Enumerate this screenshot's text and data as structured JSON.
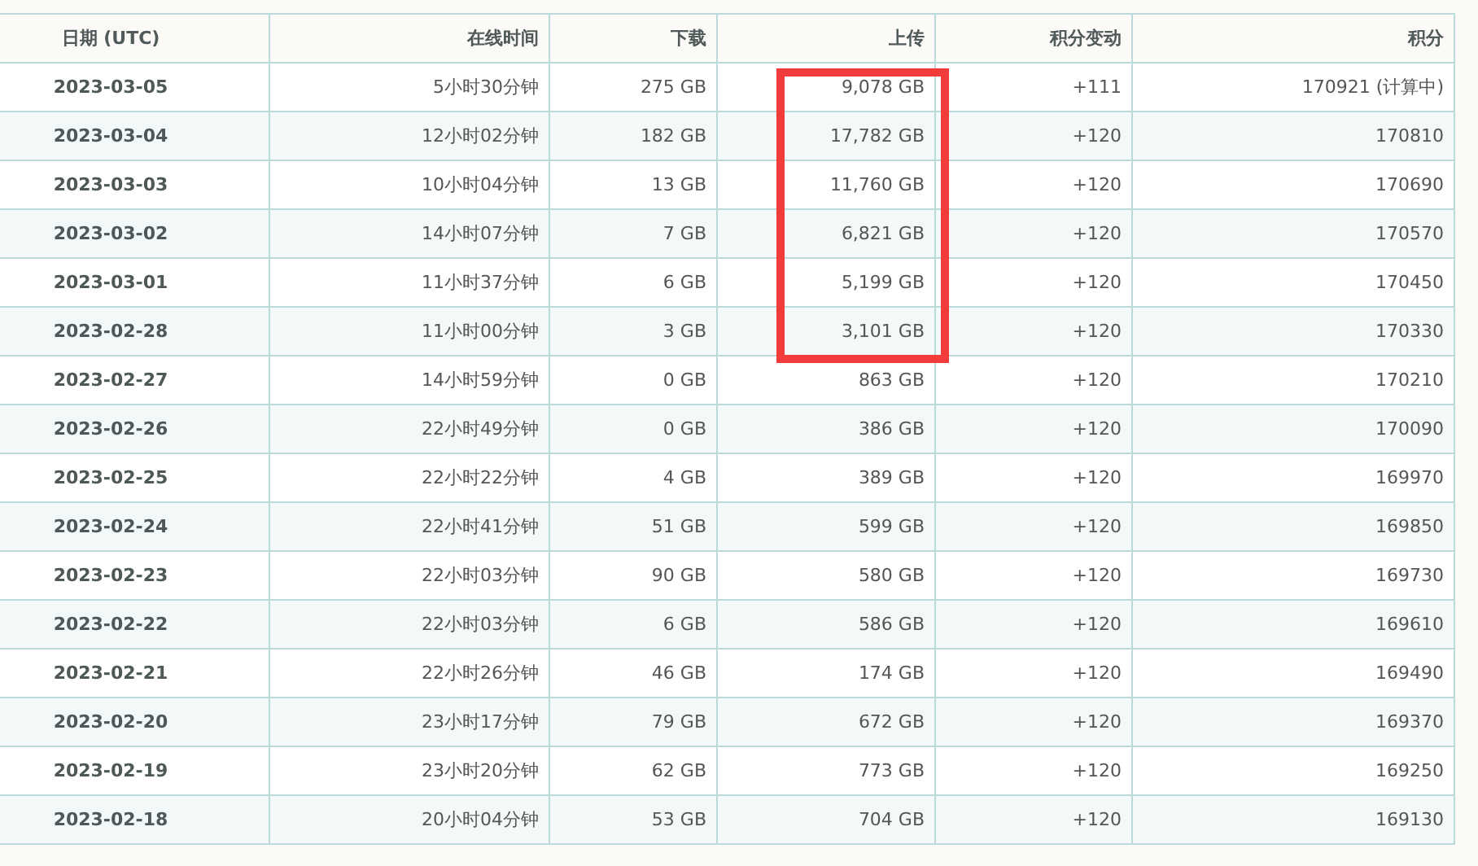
{
  "annotation": {
    "kind": "box"
  },
  "table": {
    "columns": [
      "日期 (UTC)",
      "在线时间",
      "下载",
      "上传",
      "积分变动",
      "积分"
    ],
    "rows": [
      {
        "date": "2023-03-05",
        "online": "5小时30分钟",
        "download": "275 GB",
        "upload": "9,078 GB",
        "change": "+111",
        "points": "170921 (计算中)"
      },
      {
        "date": "2023-03-04",
        "online": "12小时02分钟",
        "download": "182 GB",
        "upload": "17,782 GB",
        "change": "+120",
        "points": "170810"
      },
      {
        "date": "2023-03-03",
        "online": "10小时04分钟",
        "download": "13 GB",
        "upload": "11,760 GB",
        "change": "+120",
        "points": "170690"
      },
      {
        "date": "2023-03-02",
        "online": "14小时07分钟",
        "download": "7 GB",
        "upload": "6,821 GB",
        "change": "+120",
        "points": "170570"
      },
      {
        "date": "2023-03-01",
        "online": "11小时37分钟",
        "download": "6 GB",
        "upload": "5,199 GB",
        "change": "+120",
        "points": "170450"
      },
      {
        "date": "2023-02-28",
        "online": "11小时00分钟",
        "download": "3 GB",
        "upload": "3,101 GB",
        "change": "+120",
        "points": "170330"
      },
      {
        "date": "2023-02-27",
        "online": "14小时59分钟",
        "download": "0 GB",
        "upload": "863 GB",
        "change": "+120",
        "points": "170210"
      },
      {
        "date": "2023-02-26",
        "online": "22小时49分钟",
        "download": "0 GB",
        "upload": "386 GB",
        "change": "+120",
        "points": "170090"
      },
      {
        "date": "2023-02-25",
        "online": "22小时22分钟",
        "download": "4 GB",
        "upload": "389 GB",
        "change": "+120",
        "points": "169970"
      },
      {
        "date": "2023-02-24",
        "online": "22小时41分钟",
        "download": "51 GB",
        "upload": "599 GB",
        "change": "+120",
        "points": "169850"
      },
      {
        "date": "2023-02-23",
        "online": "22小时03分钟",
        "download": "90 GB",
        "upload": "580 GB",
        "change": "+120",
        "points": "169730"
      },
      {
        "date": "2023-02-22",
        "online": "22小时03分钟",
        "download": "6 GB",
        "upload": "586 GB",
        "change": "+120",
        "points": "169610"
      },
      {
        "date": "2023-02-21",
        "online": "22小时26分钟",
        "download": "46 GB",
        "upload": "174 GB",
        "change": "+120",
        "points": "169490"
      },
      {
        "date": "2023-02-20",
        "online": "23小时17分钟",
        "download": "79 GB",
        "upload": "672 GB",
        "change": "+120",
        "points": "169370"
      },
      {
        "date": "2023-02-19",
        "online": "23小时20分钟",
        "download": "62 GB",
        "upload": "773 GB",
        "change": "+120",
        "points": "169250"
      },
      {
        "date": "2023-02-18",
        "online": "20小时04分钟",
        "download": "53 GB",
        "upload": "704 GB",
        "change": "+120",
        "points": "169130"
      }
    ]
  }
}
